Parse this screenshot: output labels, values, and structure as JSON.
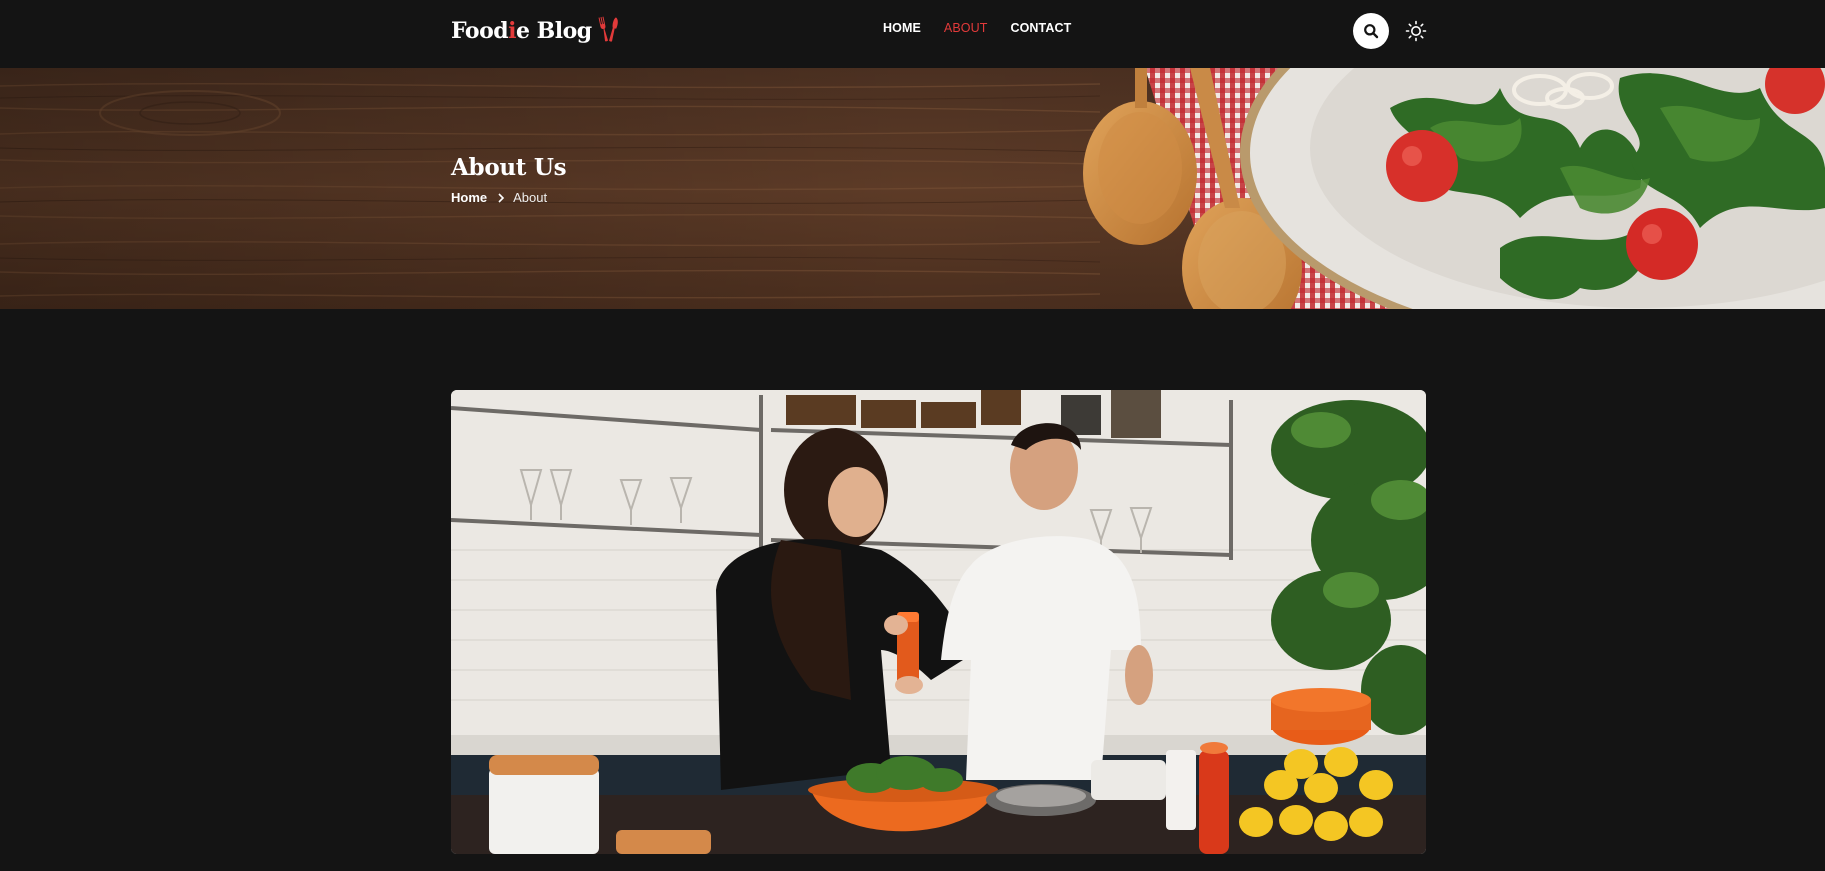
{
  "brand": {
    "part1": "Food",
    "accent_letter": "i",
    "part2": "e Blog",
    "accent_color": "#e23a3a"
  },
  "nav": {
    "items": [
      {
        "label": "HOME",
        "active": false
      },
      {
        "label": "ABOUT",
        "active": true
      },
      {
        "label": "CONTACT",
        "active": false
      }
    ]
  },
  "header_actions": {
    "search_icon": "search-icon",
    "theme_icon": "sun-icon"
  },
  "banner": {
    "title": "About Us"
  },
  "breadcrumb": {
    "home": "Home",
    "separator_icon": "chevron-right-icon",
    "current": "About"
  },
  "hero": {
    "image": "couple-cooking-in-kitchen-photo"
  },
  "colors": {
    "background": "#141414",
    "accent": "#e23a3a",
    "text": "#ffffff"
  }
}
